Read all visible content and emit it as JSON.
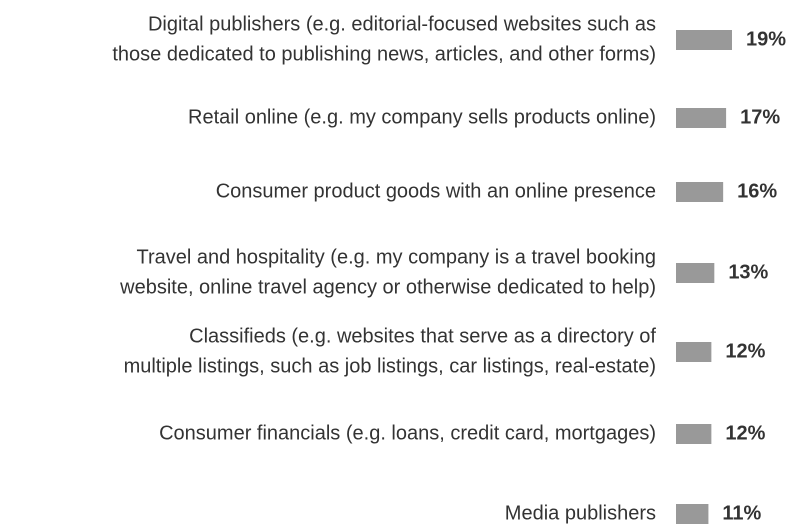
{
  "chart_data": {
    "type": "bar",
    "orientation": "horizontal",
    "title": "",
    "xlabel": "",
    "ylabel": "",
    "categories": [
      [
        "Digital publishers (e.g. editorial-focused websites such as",
        "those dedicated to publishing news, articles, and other forms)"
      ],
      [
        "Retail online (e.g. my company sells products online)"
      ],
      [
        "Consumer product goods with an online presence"
      ],
      [
        "Travel and hospitality (e.g. my company is a travel booking",
        "website, online travel agency or otherwise dedicated to help)"
      ],
      [
        "Classifieds (e.g. websites that serve as a directory of",
        "multiple listings, such as job listings, car listings, real-estate)"
      ],
      [
        "Consumer financials (e.g. loans, credit card, mortgages)"
      ],
      [
        "Media publishers"
      ]
    ],
    "values": [
      19,
      17,
      16,
      13,
      12,
      12,
      11
    ],
    "value_labels": [
      "19%",
      "17%",
      "16%",
      "13%",
      "12%",
      "12%",
      "11%"
    ],
    "unit": "%",
    "xlim": [
      0,
      19
    ],
    "grid": false,
    "legend": "none",
    "bar_color": "#999999",
    "text_color": "#333333"
  }
}
